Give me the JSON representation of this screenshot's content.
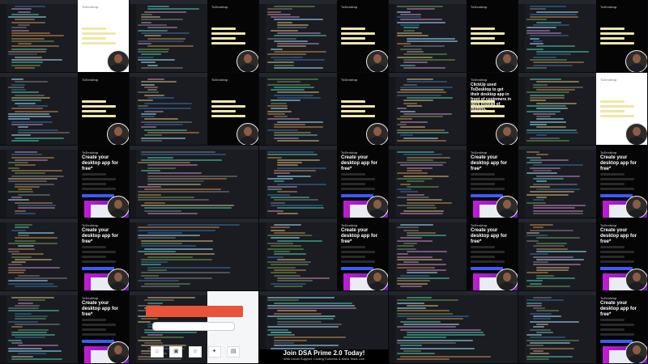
{
  "preview_texts": {
    "headline_create": "Create your desktop app for free*",
    "headline_clickup": "ClickUp used ToDesktop to get their desktop app in front of customers in days instead of months.",
    "logo": "ToDesktop"
  },
  "promo": {
    "title": "Join DSA Prime 2.0 Today!",
    "subtitle": "With Doubt Support, Coding Contests & Mock Tests Live"
  },
  "icons": [
    "home-icon",
    "bag-icon",
    "user-icon",
    "gift-icon",
    "store-icon"
  ],
  "colors": {
    "accent": "#3b5bfd",
    "highlight": "#efe7a8",
    "banner": "#e8533a",
    "magenta": "#c21bd6"
  }
}
